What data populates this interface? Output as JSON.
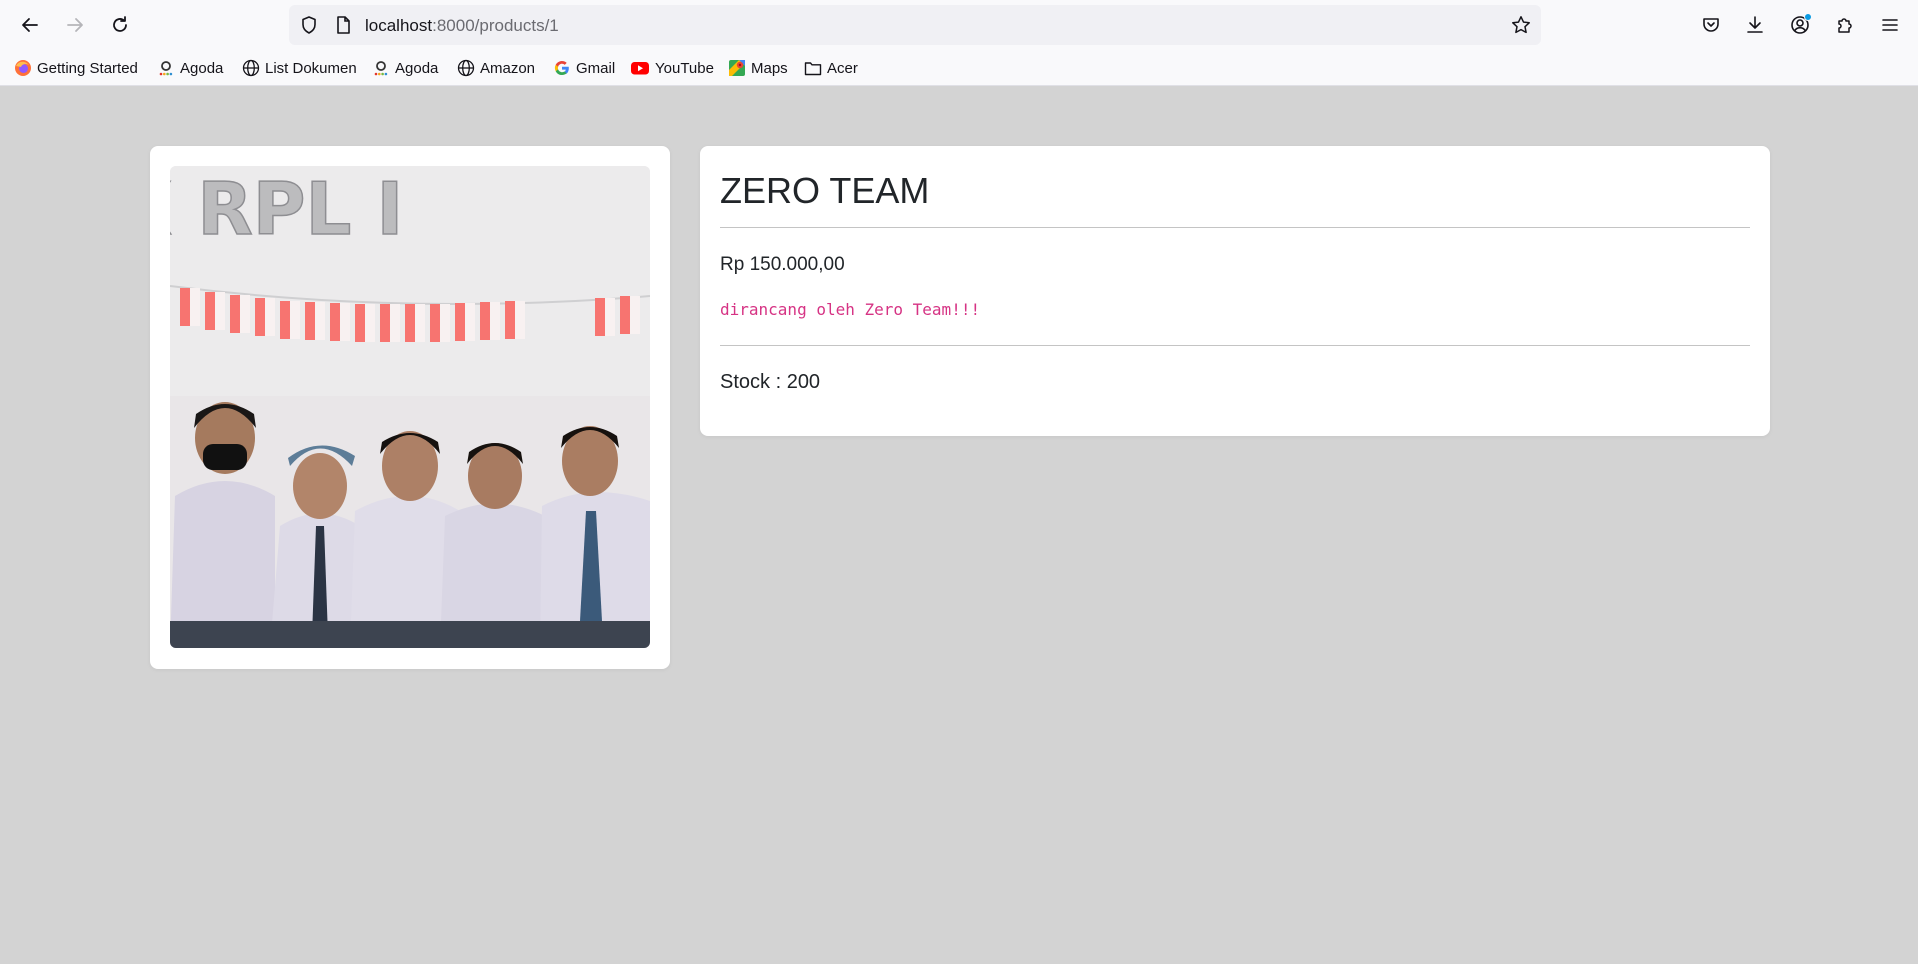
{
  "browser": {
    "url_host": "localhost",
    "url_path": ":8000/products/1",
    "icons": {
      "back": "arrow-left-icon",
      "forward": "arrow-right-icon",
      "reload": "reload-icon",
      "shield": "shield-icon",
      "page": "page-icon",
      "star": "star-icon",
      "pocket": "pocket-icon",
      "download": "download-icon",
      "account": "account-icon",
      "extensions": "puzzle-icon",
      "menu": "hamburger-menu-icon"
    }
  },
  "bookmarks": [
    {
      "label": "Getting Started",
      "icon": "firefox-icon"
    },
    {
      "label": "Agoda",
      "icon": "agoda-icon"
    },
    {
      "label": "List Dokumen",
      "icon": "globe-icon"
    },
    {
      "label": "Agoda",
      "icon": "agoda-icon"
    },
    {
      "label": "Amazon",
      "icon": "globe-icon"
    },
    {
      "label": "Gmail",
      "icon": "google-icon"
    },
    {
      "label": "YouTube",
      "icon": "youtube-icon"
    },
    {
      "label": "Maps",
      "icon": "maps-icon"
    },
    {
      "label": "Acer",
      "icon": "folder-icon"
    }
  ],
  "product": {
    "title": "ZERO TEAM",
    "price": "Rp 150.000,00",
    "description": "dirancang oleh Zero Team!!!",
    "stock": "Stock : 200",
    "image_text": "X RPL I"
  },
  "colors": {
    "page_background": "#d3d3d3",
    "card": "#ffffff",
    "description": "#d63384",
    "text": "#212529"
  }
}
